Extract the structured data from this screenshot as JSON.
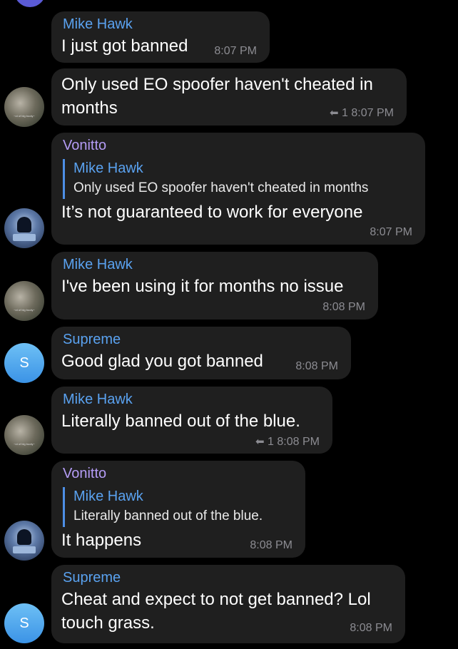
{
  "messages": [
    {
      "sender": "Mike Hawk",
      "text": "I just got banned",
      "time": "8:07 PM"
    },
    {
      "text_lines": [
        "Only used EO spoofer haven't cheated in",
        "months"
      ],
      "reply_count": "1",
      "time": "8:07 PM"
    },
    {
      "sender": "Vonitto",
      "quote_name": "Mike Hawk",
      "quote_text": "Only used EO spoofer haven't cheated in months",
      "text": "It’s not guaranteed to work for everyone",
      "time": "8:07 PM"
    },
    {
      "sender": "Mike Hawk",
      "text": "I've been using it for months no issue",
      "time": "8:08 PM"
    },
    {
      "sender": "Supreme",
      "text": "Good glad you got banned",
      "time": "8:08 PM"
    },
    {
      "sender": "Mike Hawk",
      "text": "Literally banned out of the blue.",
      "reply_count": "1",
      "time": "8:08 PM"
    },
    {
      "sender": "Vonitto",
      "quote_name": "Mike Hawk",
      "quote_text": "Literally banned out of the blue.",
      "text": "It happens",
      "time": "8:08 PM"
    },
    {
      "sender": "Supreme",
      "text_lines": [
        "Cheat and expect to not get banned? Lol",
        "touch grass."
      ],
      "time": "8:08 PM"
    }
  ],
  "avatars": {
    "supreme_letter": "S"
  },
  "icons": {
    "reply": "reply-arrow-icon"
  },
  "colors": {
    "name_blue": "#5aa2f0",
    "name_purple": "#b49cf5",
    "bubble": "#1f1f1f",
    "quote_bar": "#4d8fe6",
    "supreme_avatar": "#3b93e6"
  }
}
